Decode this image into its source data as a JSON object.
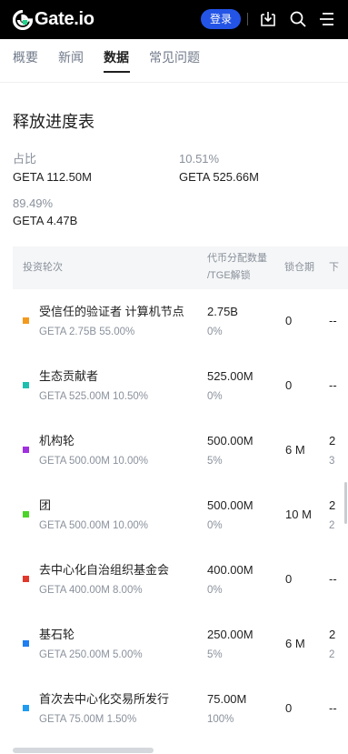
{
  "header": {
    "brand": "Gate.io",
    "login_label": "登录",
    "icons": [
      "download-icon",
      "search-icon",
      "menu-icon"
    ]
  },
  "tabs": [
    {
      "label": "概要",
      "active": false
    },
    {
      "label": "新闻",
      "active": false
    },
    {
      "label": "数据",
      "active": true
    },
    {
      "label": "常见问题",
      "active": false
    }
  ],
  "section": {
    "title": "释放进度表",
    "stats": [
      {
        "label": "占比",
        "value": "GETA 112.50M"
      },
      {
        "label": "10.51%",
        "value": "GETA 525.66M"
      },
      {
        "label": "89.49%",
        "value": "GETA 4.47B"
      }
    ]
  },
  "table": {
    "headers": {
      "round": "投资轮次",
      "allocation_line1": "代币分配数量",
      "allocation_line2": "/TGE解锁",
      "lock": "锁仓期",
      "next": "下"
    },
    "rows": [
      {
        "name": "受信任的验证者 计算机节点",
        "sub": "GETA 2.75B 55.00%",
        "amount": "2.75B",
        "tge": "0%",
        "lock": "0",
        "next": "--",
        "next_sub": "",
        "color": "#f39a1e"
      },
      {
        "name": "生态贡献者",
        "sub": "GETA 525.00M 10.50%",
        "amount": "525.00M",
        "tge": "0%",
        "lock": "0",
        "next": "--",
        "next_sub": "",
        "color": "#1fbfae"
      },
      {
        "name": "机构轮",
        "sub": "GETA 500.00M 10.00%",
        "amount": "500.00M",
        "tge": "5%",
        "lock": "6 M",
        "next": "2",
        "next_sub": "3",
        "color": "#a030e0"
      },
      {
        "name": "团",
        "sub": "GETA 500.00M 10.00%",
        "amount": "500.00M",
        "tge": "0%",
        "lock": "10 M",
        "next": "2",
        "next_sub": "2",
        "color": "#4cd42a"
      },
      {
        "name": "去中心化自治组织基金会",
        "sub": "GETA 400.00M 8.00%",
        "amount": "400.00M",
        "tge": "0%",
        "lock": "0",
        "next": "--",
        "next_sub": "",
        "color": "#e2372b"
      },
      {
        "name": "基石轮",
        "sub": "GETA 250.00M 5.00%",
        "amount": "250.00M",
        "tge": "5%",
        "lock": "6 M",
        "next": "2",
        "next_sub": "2",
        "color": "#1f7ef0"
      },
      {
        "name": "首次去中心化交易所发行",
        "sub": "GETA 75.00M 1.50%",
        "amount": "75.00M",
        "tge": "100%",
        "lock": "0",
        "next": "--",
        "next_sub": "",
        "color": "#1f9cf0"
      }
    ]
  },
  "colors": {
    "header_bg": "#000000",
    "login_bg": "#2354e6",
    "table_header_bg": "#f5f6f7"
  }
}
